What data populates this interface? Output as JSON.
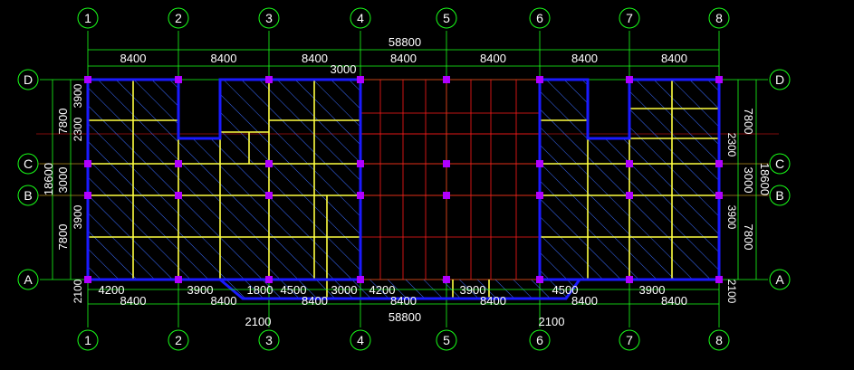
{
  "drawing": {
    "grid_x_labels": [
      "1",
      "2",
      "3",
      "4",
      "5",
      "6",
      "7",
      "8"
    ],
    "grid_y_labels": [
      "D",
      "C",
      "B",
      "A"
    ],
    "top_total": "58800",
    "top_spans": [
      "8400",
      "8400",
      "8400",
      "8400",
      "8400",
      "8400",
      "8400"
    ],
    "top_extra": "3000",
    "bottom_total": "58800",
    "bottom_spans": [
      "8400",
      "8400",
      "8400",
      "8400",
      "8400",
      "8400",
      "8400"
    ],
    "bottom_sub": [
      "4200",
      "3900",
      "1800",
      "4500",
      "3000",
      "4200",
      "3900",
      "4500",
      "3900"
    ],
    "bottom_offsets": [
      "2100",
      "2100"
    ],
    "left_total": "18600",
    "left_spans": [
      "7800",
      "3000",
      "7800"
    ],
    "left_sub": [
      "3900",
      "2100",
      "2300",
      "3900"
    ],
    "right_total": "18600",
    "right_spans": [
      "7800",
      "3000",
      "7800"
    ],
    "right_sub": [
      "2300",
      "3900",
      "2100"
    ],
    "colors": {
      "background": "#000000",
      "axis_circle": "#19ff19",
      "dimension_text": "#ffffff",
      "dimension_line": "#19ff19",
      "grid_line": "#ff1a1a",
      "slab_outline": "#1a1aff",
      "hatch": "#3a6cff",
      "beam": "#ffff40",
      "column": "#b000ff"
    }
  }
}
